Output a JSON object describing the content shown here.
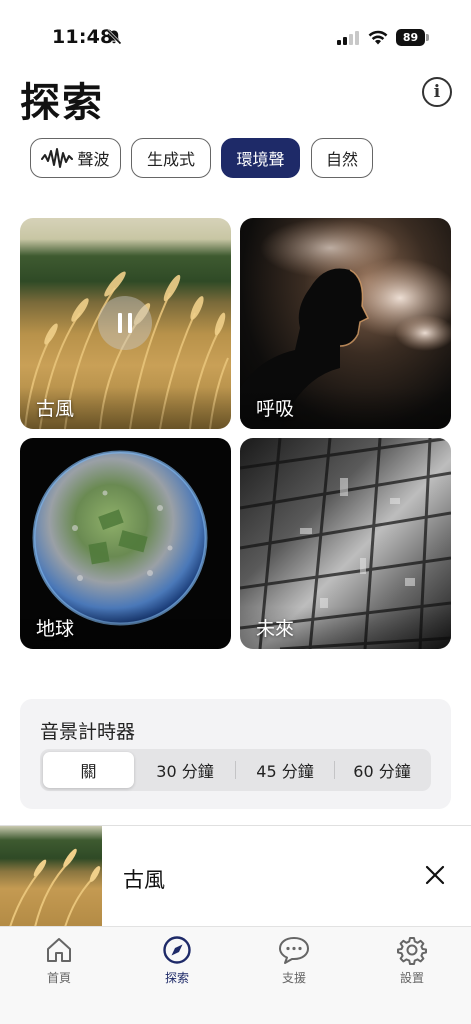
{
  "status": {
    "time": "11:48",
    "battery": "89"
  },
  "header": {
    "title": "探索"
  },
  "chips": [
    {
      "label": "聲波",
      "active": false
    },
    {
      "label": "生成式",
      "active": false
    },
    {
      "label": "環境聲",
      "active": true
    },
    {
      "label": "自然",
      "active": false
    }
  ],
  "tiles": [
    {
      "label": "古風",
      "playing": true
    },
    {
      "label": "呼吸",
      "playing": false
    },
    {
      "label": "地球",
      "playing": false
    },
    {
      "label": "未來",
      "playing": false
    }
  ],
  "timer": {
    "title": "音景計時器",
    "options": [
      "關",
      "30 分鐘",
      "45 分鐘",
      "60 分鐘"
    ],
    "selected": "關"
  },
  "now_playing": {
    "title": "古風"
  },
  "tabbar": {
    "items": [
      {
        "label": "首頁",
        "icon": "home-icon"
      },
      {
        "label": "探索",
        "icon": "compass-icon"
      },
      {
        "label": "支援",
        "icon": "chat-bubble-icon"
      },
      {
        "label": "設置",
        "icon": "gear-icon"
      }
    ],
    "active": "探索"
  },
  "colors": {
    "accent": "#1e2a68",
    "card_bg": "#f3f3f5",
    "segment_bg": "#e4e4e6"
  }
}
